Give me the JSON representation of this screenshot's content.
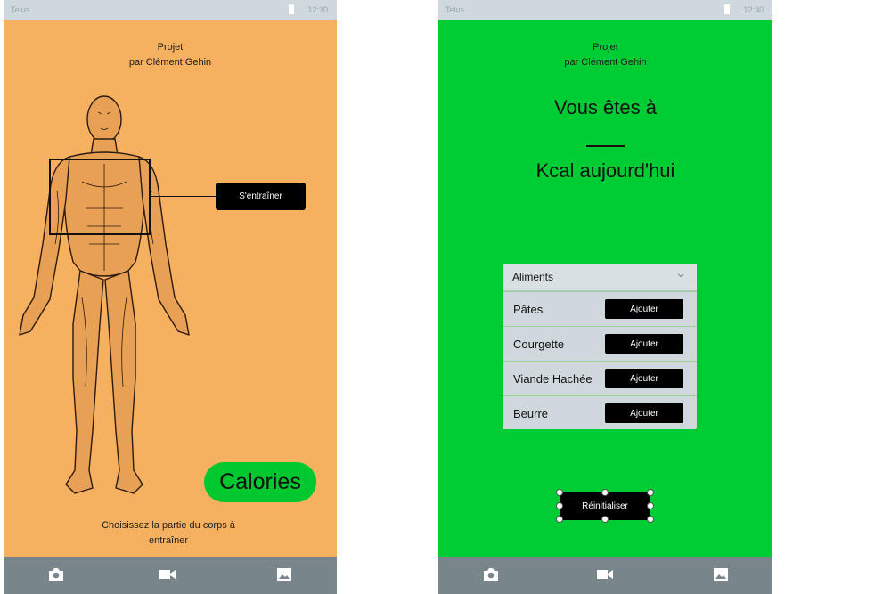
{
  "left_screen": {
    "status_bar": {
      "carrier": "Telus",
      "time": "12:30"
    },
    "title": {
      "line1": "Projet",
      "line2": "par Clément Gehin"
    },
    "body_figure": {
      "icon": "anatomy-figure-icon"
    },
    "train_button": {
      "label": "S'entraîner"
    },
    "calories_button": {
      "label": "Calories",
      "color": "#00c82e"
    },
    "instruction": {
      "line1": "Choisissez la partie du corps à",
      "line2": "entraîner"
    },
    "background": "#f5b060"
  },
  "right_screen": {
    "status_bar": {
      "carrier": "Telus",
      "time": "12:30"
    },
    "title": {
      "line1": "Projet",
      "line2": "par Clément Gehin"
    },
    "kcal": {
      "line1": "Vous êtes à",
      "blank": "____",
      "line2": "Kcal aujourd'hui"
    },
    "food_list": {
      "header": "Aliments",
      "add_label": "Ajouter",
      "items": [
        {
          "name": "Pâtes",
          "button": "Ajouter"
        },
        {
          "name": "Courgette",
          "button": "Ajouter"
        },
        {
          "name": "Viande Hachée",
          "button": "Ajouter"
        },
        {
          "name": "Beurre",
          "button": "Ajouter"
        }
      ]
    },
    "reset_button": {
      "label": "Réinitialiser"
    },
    "background": "#00cc33"
  },
  "bottom_nav": {
    "icons": [
      "camera-icon",
      "video-camera-icon",
      "gallery-icon"
    ]
  }
}
